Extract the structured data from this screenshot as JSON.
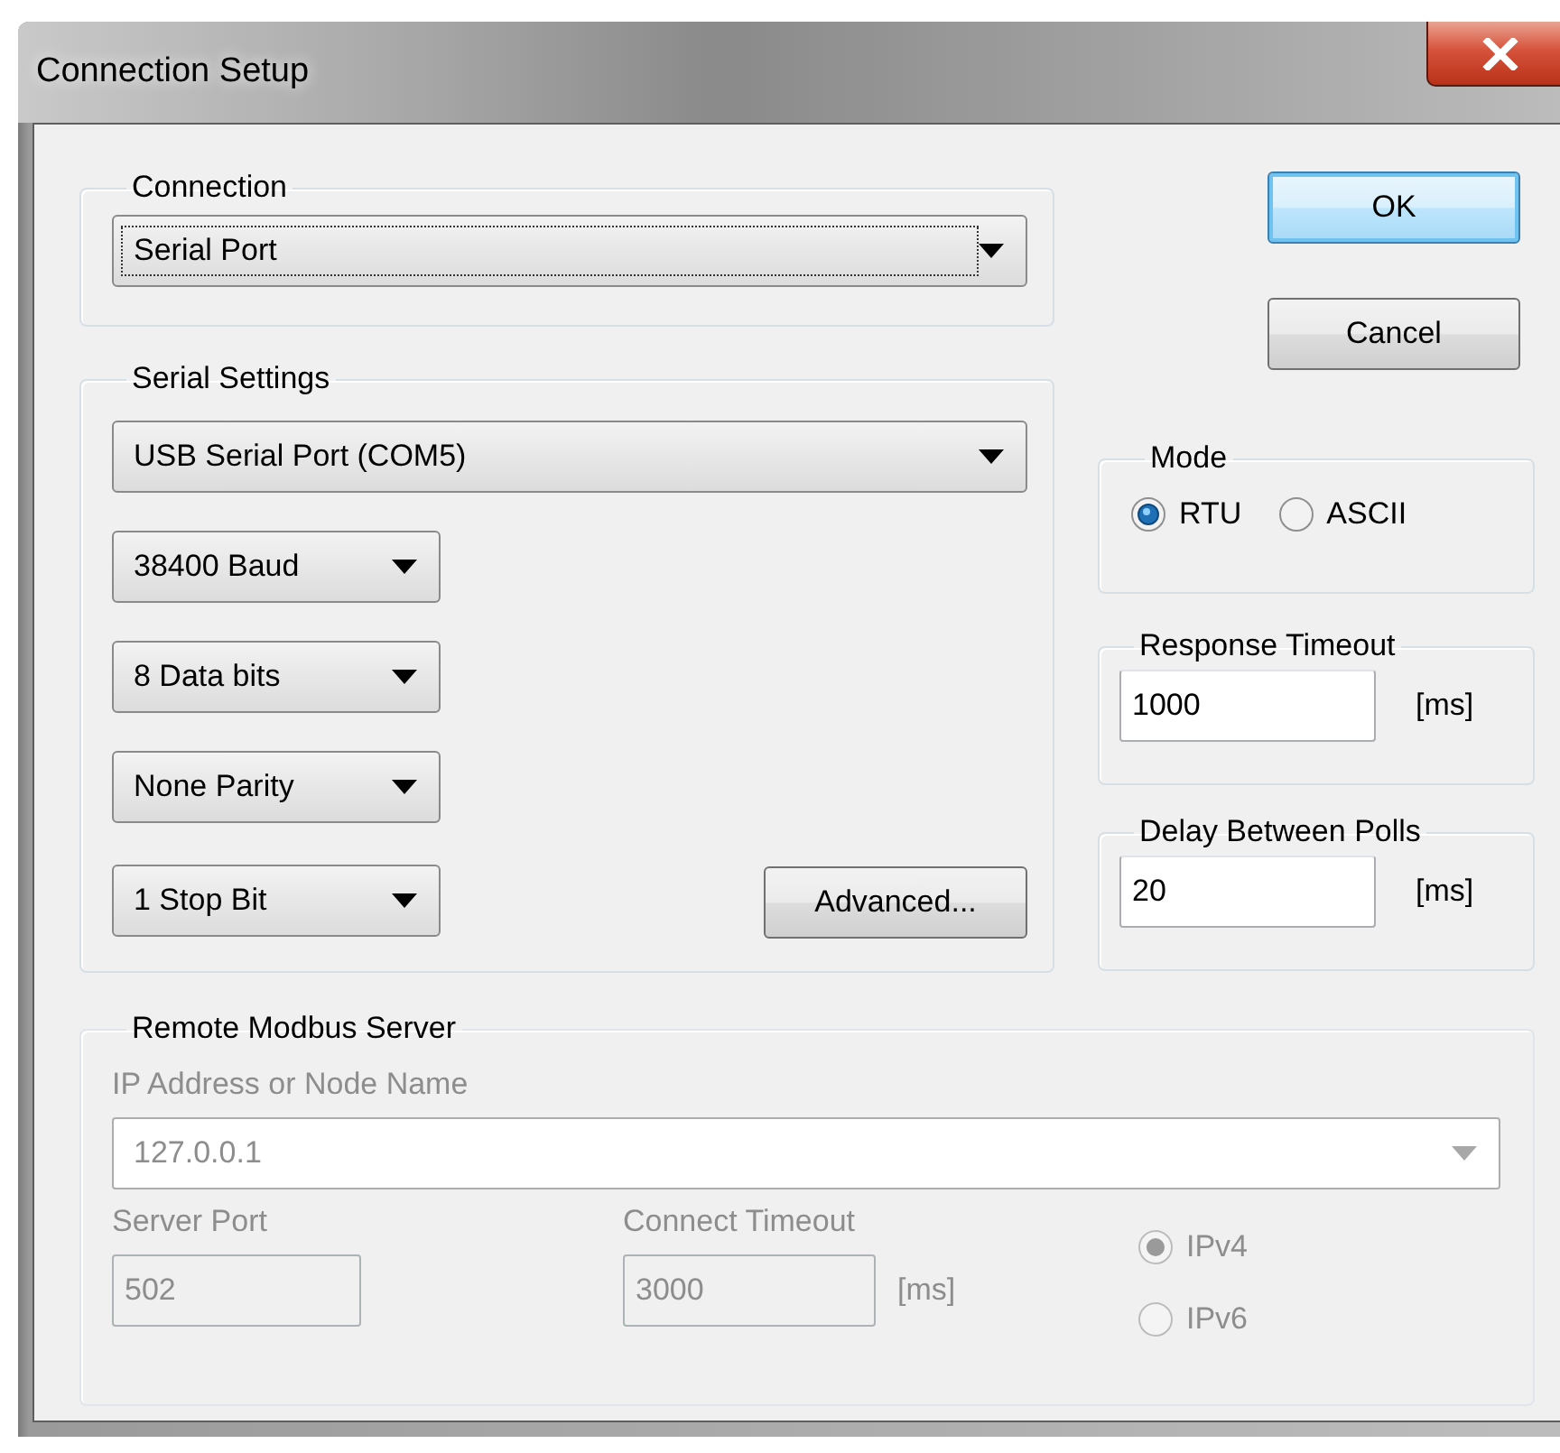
{
  "window": {
    "title": "Connection Setup"
  },
  "connection": {
    "label": "Connection",
    "combo": {
      "value": "Serial Port",
      "focused": true
    }
  },
  "buttons": [
    {
      "label": "OK",
      "default": true
    },
    {
      "label": "Cancel",
      "default": false
    }
  ],
  "serial_settings": {
    "label": "Serial Settings",
    "port": {
      "value": "USB Serial Port (COM5)"
    },
    "options": [
      {
        "value": "38400 Baud"
      },
      {
        "value": "8 Data bits"
      },
      {
        "value": "None Parity"
      },
      {
        "value": "1 Stop Bit"
      }
    ],
    "advanced_button": "Advanced..."
  },
  "mode": {
    "label": "Mode",
    "options": [
      {
        "label": "RTU",
        "selected": true
      },
      {
        "label": "ASCII",
        "selected": false
      }
    ]
  },
  "response_timeout": {
    "label": "Response Timeout",
    "value": "1000",
    "unit": "[ms]"
  },
  "delay_between_polls": {
    "label": "Delay Between Polls",
    "value": "20",
    "unit": "[ms]"
  },
  "remote_server": {
    "label": "Remote Modbus Server",
    "disabled": true,
    "address_label": "IP Address or Node Name",
    "address": "127.0.0.1",
    "port_label": "Server Port",
    "port": "502",
    "timeout_label": "Connect Timeout",
    "timeout": "3000",
    "timeout_unit": "[ms]",
    "ip_versions": [
      {
        "label": "IPv4",
        "selected": true
      },
      {
        "label": "IPv6",
        "selected": false
      }
    ]
  }
}
